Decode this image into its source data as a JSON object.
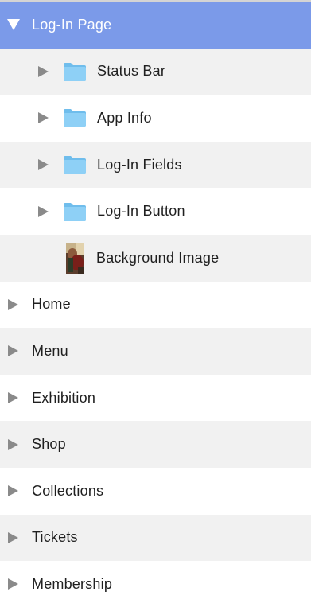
{
  "layers": {
    "selected": {
      "label": "Log-In Page",
      "icon": "triangle-down-icon",
      "background": "#7b9ae9"
    },
    "children": [
      {
        "label": "Status Bar",
        "icon": "folder-icon"
      },
      {
        "label": "App Info",
        "icon": "folder-icon"
      },
      {
        "label": "Log-In Fields",
        "icon": "folder-icon"
      },
      {
        "label": "Log-In Button",
        "icon": "folder-icon"
      },
      {
        "label": "Background Image",
        "icon": "image-thumbnail-icon"
      }
    ],
    "pages": [
      {
        "label": "Home"
      },
      {
        "label": "Menu"
      },
      {
        "label": "Exhibition"
      },
      {
        "label": "Shop"
      },
      {
        "label": "Collections"
      },
      {
        "label": "Tickets"
      },
      {
        "label": "Membership"
      }
    ]
  },
  "colors": {
    "accent": "#7b9ae9",
    "row_alt": "#f1f1f1",
    "folder": "#8ed0f6",
    "disclosure": "#8a8a8a"
  }
}
